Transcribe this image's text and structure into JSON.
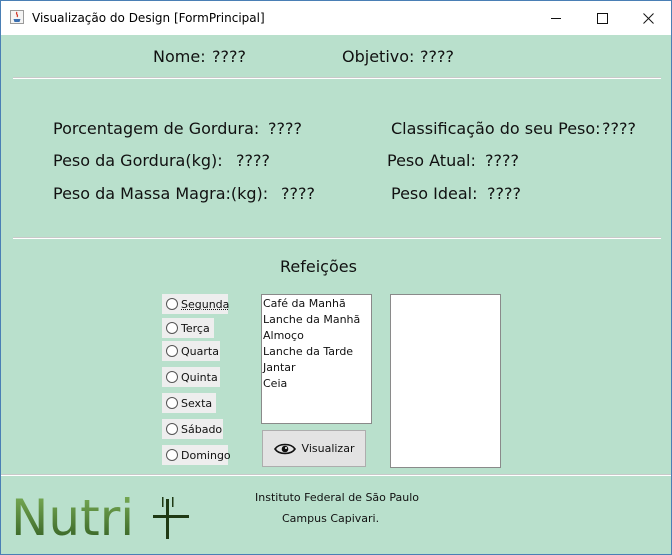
{
  "window": {
    "title": "Visualização do Design [FormPrincipal]",
    "controls": {
      "minimize": "—",
      "maximize": "☐",
      "close": "✕"
    }
  },
  "header": {
    "nome_label": "Nome:",
    "nome_value": "????",
    "objetivo_label": "Objetivo:",
    "objetivo_value": "????"
  },
  "stats": {
    "gordura_pct_label": "Porcentagem de Gordura:",
    "gordura_pct_value": "????",
    "classificacao_label": "Classificação do seu Peso:",
    "classificacao_value": "????",
    "peso_gordura_label": "Peso da Gordura(kg):",
    "peso_gordura_value": "????",
    "peso_atual_label": "Peso Atual:",
    "peso_atual_value": "????",
    "massa_magra_label": "Peso da Massa Magra:(kg):",
    "massa_magra_value": "????",
    "peso_ideal_label": "Peso Ideal:",
    "peso_ideal_value": "????"
  },
  "refeicoes": {
    "title": "Refeições",
    "days": [
      "Segunda",
      "Terça",
      "Quarta",
      "Quinta",
      "Sexta",
      "Sábado",
      "Domingo"
    ],
    "meals": [
      "Café da Manhã",
      "Lanche da Manhã",
      "Almoço",
      "Lanche da Tarde",
      "Jantar",
      "Ceia"
    ],
    "view_button": "Visualizar",
    "view_button_icon": "eye-icon"
  },
  "footer": {
    "institute": "Instituto Federal de São Paulo",
    "campus": "Campus Capivari.",
    "logo_text": "Nutri",
    "logo_icon": "fork-icon"
  },
  "colors": {
    "background": "#b9e0cc",
    "logo_dark": "#2f5a1f",
    "logo_light": "#7fb35a"
  }
}
